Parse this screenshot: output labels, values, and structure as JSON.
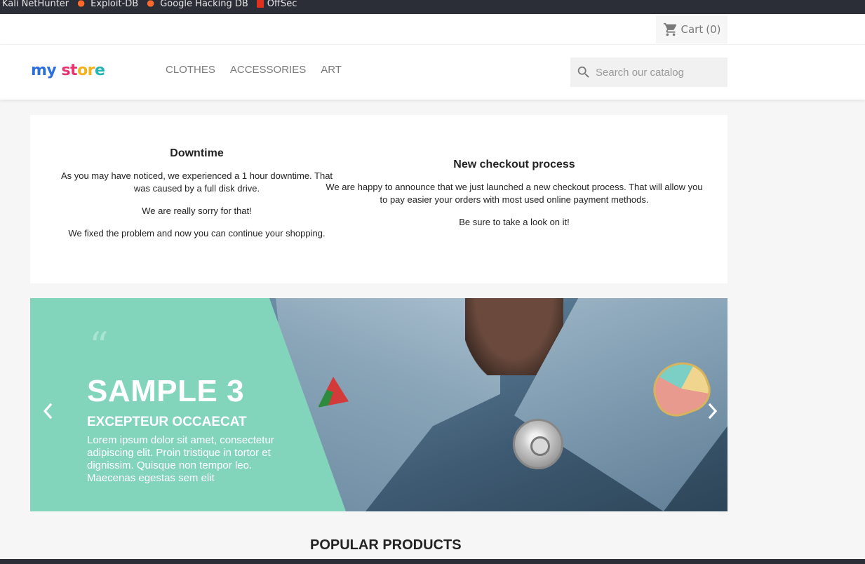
{
  "bookmarks": [
    {
      "label": "Kali NetHunter",
      "icon": "kali-icon"
    },
    {
      "label": "Exploit-DB",
      "icon": "dragon-icon"
    },
    {
      "label": "Google Hacking DB",
      "icon": "dragon-icon"
    },
    {
      "label": "OffSec",
      "icon": "offsec-icon"
    }
  ],
  "header": {
    "cart_label": "Cart",
    "cart_count": "(0)",
    "logo": {
      "part1": "my",
      "part2": "st",
      "part3": "or",
      "part4": "e"
    },
    "nav": [
      "CLOTHES",
      "ACCESSORIES",
      "ART"
    ],
    "search_placeholder": "Search our catalog"
  },
  "custom_text": {
    "left": {
      "title": "Downtime",
      "paragraphs": [
        "As you may have noticed, we experienced a 1 hour downtime. That was caused by a full disk drive.",
        "We are really sorry for that!",
        "We fixed the problem and now you can continue your shopping."
      ]
    },
    "right": {
      "title": "New checkout process",
      "paragraphs": [
        "We are happy to announce that we just launched a new checkout process. That will allow you to pay easier your orders with most used online payment methods.",
        "Be sure to take a look on it!"
      ]
    }
  },
  "slider": {
    "quote": "“",
    "title": "SAMPLE 3",
    "subtitle": "EXCEPTEUR OCCAECAT",
    "text": "Lorem ipsum dolor sit amet, consectetur adipiscing elit. Proin tristique in tortor et dignissim. Quisque non tempor leo. Maecenas egestas sem elit"
  },
  "popular_title": "POPULAR PRODUCTS",
  "colors": {
    "accent": "#24b9d7",
    "slide_panel": "#82d4bb",
    "bookmarks_bg": "#2b2e37"
  }
}
